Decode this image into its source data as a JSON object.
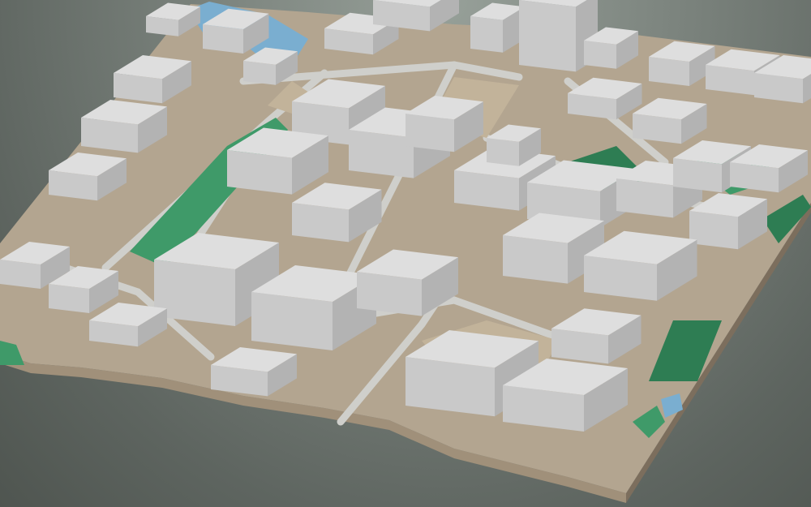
{
  "scene": {
    "kind": "isometric-3d-city-block-model",
    "view": "oblique aerial"
  },
  "colors": {
    "background_top": "#97a099",
    "background_bottom": "#505651",
    "ground": "#b3a590",
    "base_side": "#a0907a",
    "base_side_dark": "#7c6e5d",
    "road": "#cfcfcb",
    "plaza": "#c2b39a",
    "building_top": "#dedede",
    "building_left": "#c9c9c9",
    "building_right": "#b3b3b3",
    "vegetation": "#3f9a69",
    "vegetation_dark": "#2e7d53",
    "water": "#7aaed0"
  },
  "features": {
    "water_bodies": 2,
    "green_strips": 7,
    "open_plazas": 3
  }
}
